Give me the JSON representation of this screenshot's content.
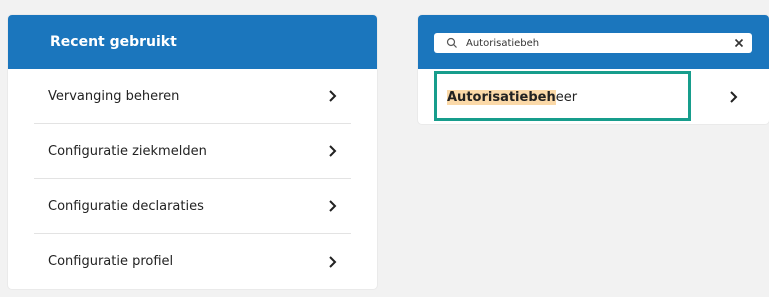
{
  "recent_panel": {
    "title": "Recent gebruikt",
    "items": [
      {
        "label": "Vervanging beheren"
      },
      {
        "label": "Configuratie ziekmelden"
      },
      {
        "label": "Configuratie declaraties"
      },
      {
        "label": "Configuratie profiel"
      }
    ]
  },
  "search_panel": {
    "query": "Autorisatiebeh",
    "result": {
      "match": "Autorisatiebeh",
      "rest": "eer"
    }
  },
  "colors": {
    "header_blue": "#1b76bd",
    "highlight": "#fbd9a8",
    "focus_frame": "#179d8c",
    "background": "#f2f2f2"
  },
  "icons": {
    "chevron": "chevron-right-icon",
    "search": "search-icon",
    "clear": "close-icon"
  }
}
